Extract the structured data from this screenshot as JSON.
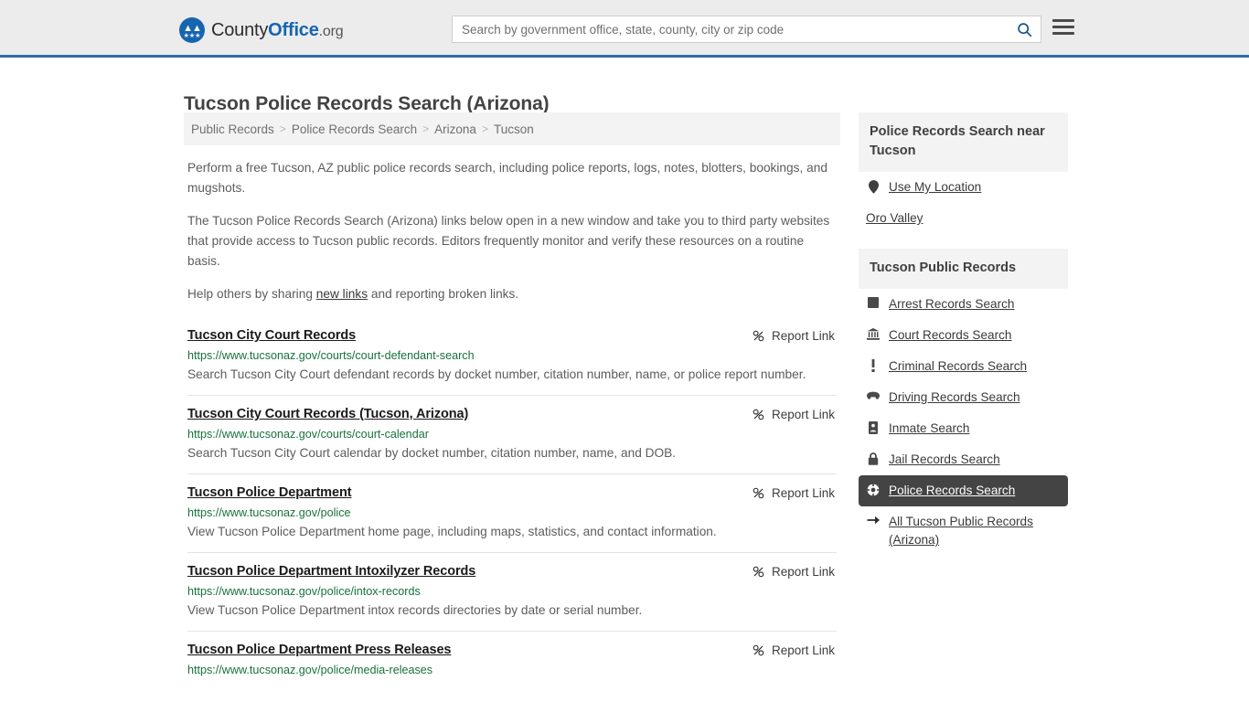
{
  "header": {
    "logo": {
      "part1": "County",
      "part2": "Office",
      "part3": ".org",
      "icon_eagle": "eagle-icon",
      "icon_stars": "★★★"
    },
    "search": {
      "placeholder": "Search by government office, state, county, city or zip code",
      "value": "",
      "icon": "search-icon"
    },
    "menu_icon": "hamburger-menu-icon",
    "accent_color": "#2f6ea5"
  },
  "page": {
    "title": "Tucson Police Records Search (Arizona)"
  },
  "breadcrumb": {
    "separator": ">",
    "items": [
      {
        "label": "Public Records"
      },
      {
        "label": "Police Records Search"
      },
      {
        "label": "Arizona"
      },
      {
        "label": "Tucson"
      }
    ]
  },
  "intro": {
    "p1": "Perform a free Tucson, AZ public police records search, including police reports, logs, notes, blotters, bookings, and mugshots.",
    "p2": "The Tucson Police Records Search (Arizona) links below open in a new window and take you to third party websites that provide access to Tucson public records. Editors frequently monitor and verify these resources on a routine basis.",
    "p3_before": "Help others by sharing ",
    "p3_link": "new links",
    "p3_after": " and reporting broken links."
  },
  "results": {
    "report_label": "Report Link",
    "report_icon": "broken-link-icon",
    "items": [
      {
        "title": "Tucson City Court Records",
        "url": "https://www.tucsonaz.gov/courts/court-defendant-search",
        "description": "Search Tucson City Court defendant records by docket number, citation number, name, or police report number."
      },
      {
        "title": "Tucson City Court Records (Tucson, Arizona)",
        "url": "https://www.tucsonaz.gov/courts/court-calendar",
        "description": "Search Tucson City Court calendar by docket number, citation number, name, and DOB."
      },
      {
        "title": "Tucson Police Department",
        "url": "https://www.tucsonaz.gov/police",
        "description": "View Tucson Police Department home page, including maps, statistics, and contact information."
      },
      {
        "title": "Tucson Police Department Intoxilyzer Records",
        "url": "https://www.tucsonaz.gov/police/intox-records",
        "description": "View Tucson Police Department intox records directories by date or serial number."
      },
      {
        "title": "Tucson Police Department Press Releases",
        "url": "https://www.tucsonaz.gov/police/media-releases",
        "description": ""
      }
    ]
  },
  "sidebar": {
    "nearby": {
      "header": "Police Records Search near Tucson",
      "use_location": {
        "label": "Use My Location",
        "icon": "map-pin-icon"
      },
      "places": [
        {
          "label": "Oro Valley"
        }
      ]
    },
    "public_records": {
      "header": "Tucson Public Records",
      "active_bg": "#444444",
      "items": [
        {
          "label": "Arrest Records Search",
          "icon": "fingerprint-icon",
          "active": false
        },
        {
          "label": "Court Records Search",
          "icon": "courthouse-icon",
          "active": false
        },
        {
          "label": "Criminal Records Search",
          "icon": "exclamation-icon",
          "active": false
        },
        {
          "label": "Driving Records Search",
          "icon": "car-icon",
          "active": false
        },
        {
          "label": "Inmate Search",
          "icon": "id-badge-icon",
          "active": false
        },
        {
          "label": "Jail Records Search",
          "icon": "lock-icon",
          "active": false
        },
        {
          "label": "Police Records Search",
          "icon": "police-badge-icon",
          "active": true
        },
        {
          "label": "All Tucson Public Records (Arizona)",
          "icon": "arrow-right-icon",
          "active": false
        }
      ]
    }
  }
}
